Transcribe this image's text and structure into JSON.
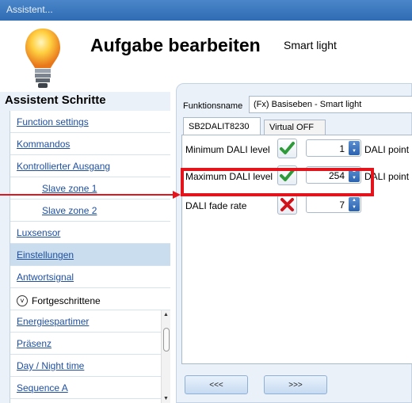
{
  "window": {
    "title": "Assistent..."
  },
  "header": {
    "title": "Aufgabe bearbeiten",
    "subtitle": "Smart light"
  },
  "sidebar": {
    "title": "Assistent Schritte",
    "items": [
      {
        "label": "Function settings"
      },
      {
        "label": "Kommandos"
      },
      {
        "label": "Kontrollierter Ausgang"
      },
      {
        "label": "Slave zone 1"
      },
      {
        "label": "Slave zone 2"
      },
      {
        "label": "Luxsensor"
      },
      {
        "label": "Einstellungen"
      },
      {
        "label": "Antwortsignal"
      },
      {
        "label": "Fortgeschrittene"
      },
      {
        "label": "Energiespartimer"
      },
      {
        "label": "Präsenz"
      },
      {
        "label": "Day / Night time"
      },
      {
        "label": "Sequence A"
      }
    ]
  },
  "panel": {
    "function_label": "Funktionsname",
    "function_value": "(Fx) Basiseben - Smart light",
    "tabs": [
      {
        "label": "SB2DALIT8230"
      },
      {
        "label": "Virtual OFF"
      }
    ],
    "rows": [
      {
        "label": "Minimum DALI level",
        "value": "1",
        "unit": "DALI point",
        "state": "check"
      },
      {
        "label": "Maximum DALI level",
        "value": "254",
        "unit": "DALI point",
        "state": "check"
      },
      {
        "label": "DALI fade rate",
        "value": "7",
        "unit": "",
        "state": "cross"
      }
    ],
    "nav": {
      "prev": "<<<",
      "next": ">>>"
    }
  },
  "colors": {
    "highlight": "#e3141b",
    "link": "#1f4fa0",
    "selected": "#c9ddee"
  },
  "icons": {
    "check": "check-icon",
    "cross": "cross-icon",
    "bulb": "bulb-icon"
  }
}
